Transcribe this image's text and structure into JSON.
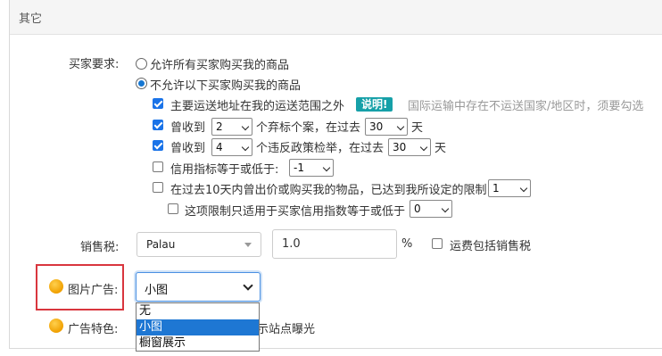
{
  "section_title": "其它",
  "buyer_requirements": {
    "label": "买家要求:",
    "radio_all": "允许所有买家购买我的商品",
    "radio_restrict": "不允许以下买家购买我的商品",
    "shipping_outside": "主要运送地址在我的运送范围之外",
    "explain_badge": "说明!",
    "explain_text": "国际运输中存在不运送国家/地区时，须要勾选",
    "strike_prefix": "曾收到",
    "strike_value": "2",
    "strike_mid": "个弃标个案，在过去",
    "strike_days": "30",
    "strike_suffix": "天",
    "policy_prefix": "曾收到",
    "policy_value": "4",
    "policy_mid": "个违反政策检举，在过去",
    "policy_days": "30",
    "policy_suffix": "天",
    "credit_label": "信用指标等于或低于:",
    "credit_value": "-1",
    "bid_limit_label": "在过去10天内曾出价或购买我的物品，已达到我所设定的限制",
    "bid_limit_value": "1",
    "only_apply_label": "这项限制只适用于买家信用指数等于或低于",
    "only_apply_value": "0"
  },
  "sales_tax": {
    "label": "销售税:",
    "region": "Palau",
    "rate": "1.0",
    "percent": "%",
    "include_shipping_label": "运费包括销售税"
  },
  "picture_ad": {
    "label": "图片广告:",
    "selected": "小图",
    "options": [
      "无",
      "小图",
      "橱窗展示"
    ]
  },
  "ad_feature": {
    "label": "广告特色:",
    "partial_text": "示站点曝光"
  },
  "colors": {
    "accent": "#1a73e8",
    "badge": "#16a0a8",
    "highlight_box": "#d9363e",
    "dropdown_selected": "#1e77d3"
  }
}
